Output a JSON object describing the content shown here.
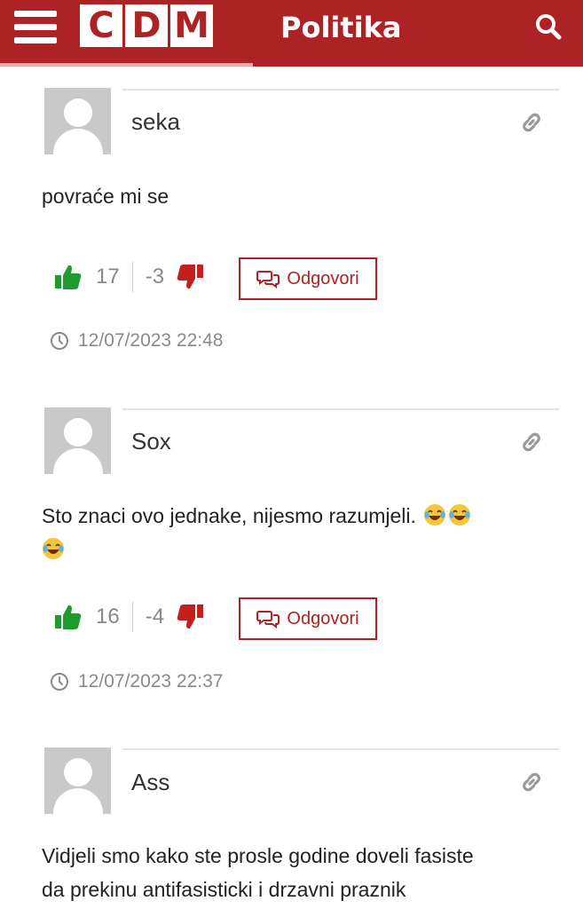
{
  "header": {
    "logo_letters": [
      "C",
      "D",
      "M"
    ],
    "section_title": "Politika",
    "brand_color": "#ad2224",
    "menu_icon": "hamburger-menu-icon",
    "search_icon": "search-icon"
  },
  "comments": [
    {
      "author": "seka",
      "text": "povraće mi se",
      "likes": "17",
      "dislikes": "-3",
      "reply_label": "Odgovori",
      "timestamp": "12/07/2023 22:48"
    },
    {
      "author": "Sox",
      "text": "Sto znaci ovo jednake, nijesmo razumjeli.",
      "emoji_icon": "face-with-tears-of-joy-icon",
      "likes": "16",
      "dislikes": "-4",
      "reply_label": "Odgovori",
      "timestamp": "12/07/2023 22:37"
    },
    {
      "author": "Ass",
      "text_line1": "Vidjeli smo kako ste prosle godine doveli fasiste",
      "text_line2": "da prekinu antifasisticki i drzavni praznik"
    }
  ],
  "colors": {
    "like_green": "#1f9a2e",
    "dislike_red": "#c21f1f",
    "avatar_gray": "#c9c9c9"
  }
}
